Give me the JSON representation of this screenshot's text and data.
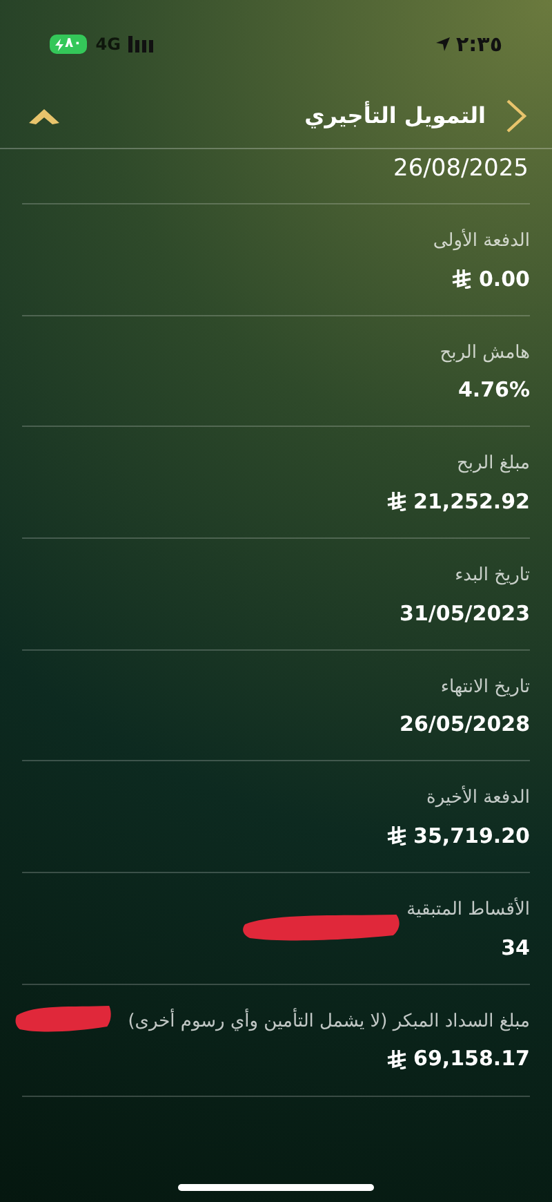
{
  "status_bar": {
    "time": "٢:٣٥",
    "network": "4G",
    "battery": "٨٠"
  },
  "header": {
    "title": "التمويل التأجيري"
  },
  "partial_row": {
    "value": "26/08/2025"
  },
  "rows": [
    {
      "label": "الدفعة الأولى",
      "value": "0.00",
      "currency": true,
      "redacted": false
    },
    {
      "label": "هامش الربح",
      "value": "4.76%",
      "currency": false,
      "redacted": false
    },
    {
      "label": "مبلغ الربح",
      "value": "21,252.92",
      "currency": true,
      "redacted": false
    },
    {
      "label": "تاريخ البدء",
      "value": "31/05/2023",
      "currency": false,
      "redacted": false
    },
    {
      "label": "تاريخ الانتهاء",
      "value": "26/05/2028",
      "currency": false,
      "redacted": false
    },
    {
      "label": "الدفعة الأخيرة",
      "value": "35,719.20",
      "currency": true,
      "redacted": false
    },
    {
      "label": "الأقساط المتبقية",
      "value": "34",
      "currency": false,
      "redacted": true
    },
    {
      "label": "مبلغ السداد المبكر (لا يشمل التأمين وأي رسوم أخرى)",
      "value": "69,158.17",
      "currency": true,
      "redacted": true
    }
  ]
}
